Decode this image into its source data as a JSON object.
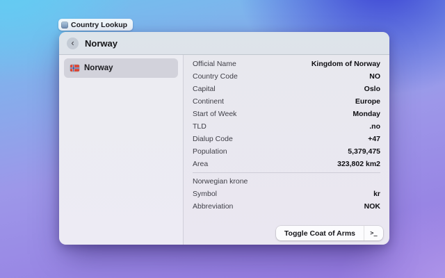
{
  "colors": {
    "bg_top_left": "#69c9ee",
    "bg_top_right": "#3c40d0",
    "bg_bottom_left": "#9477e0",
    "bg_bottom_right": "#a98fe6",
    "flag_red": "#d8402f",
    "flag_blue": "#26418c",
    "selection_gray": "#d3d6dc"
  },
  "tag": {
    "label": "Country Lookup"
  },
  "window": {
    "title": "Norway",
    "back_glyph": "‹"
  },
  "sidebar": {
    "items": [
      {
        "label": "Norway",
        "selected": true
      }
    ]
  },
  "details": {
    "main_rows": [
      {
        "label": "Official Name",
        "value": "Kingdom of Norway"
      },
      {
        "label": "Country Code",
        "value": "NO"
      },
      {
        "label": "Capital",
        "value": "Oslo"
      },
      {
        "label": "Continent",
        "value": "Europe"
      },
      {
        "label": "Start of Week",
        "value": "Monday"
      },
      {
        "label": "TLD",
        "value": ".no"
      },
      {
        "label": "Dialup Code",
        "value": "+47"
      },
      {
        "label": "Population",
        "value": "5,379,475"
      },
      {
        "label": "Area",
        "value": "323,802 km2"
      }
    ],
    "currency_header": "Norwegian krone",
    "currency_rows": [
      {
        "label": "Symbol",
        "value": "kr"
      },
      {
        "label": "Abbreviation",
        "value": "NOK"
      }
    ]
  },
  "footer": {
    "toggle_button_label": "Toggle Coat of Arms",
    "shortcut_glyph": ">_"
  }
}
